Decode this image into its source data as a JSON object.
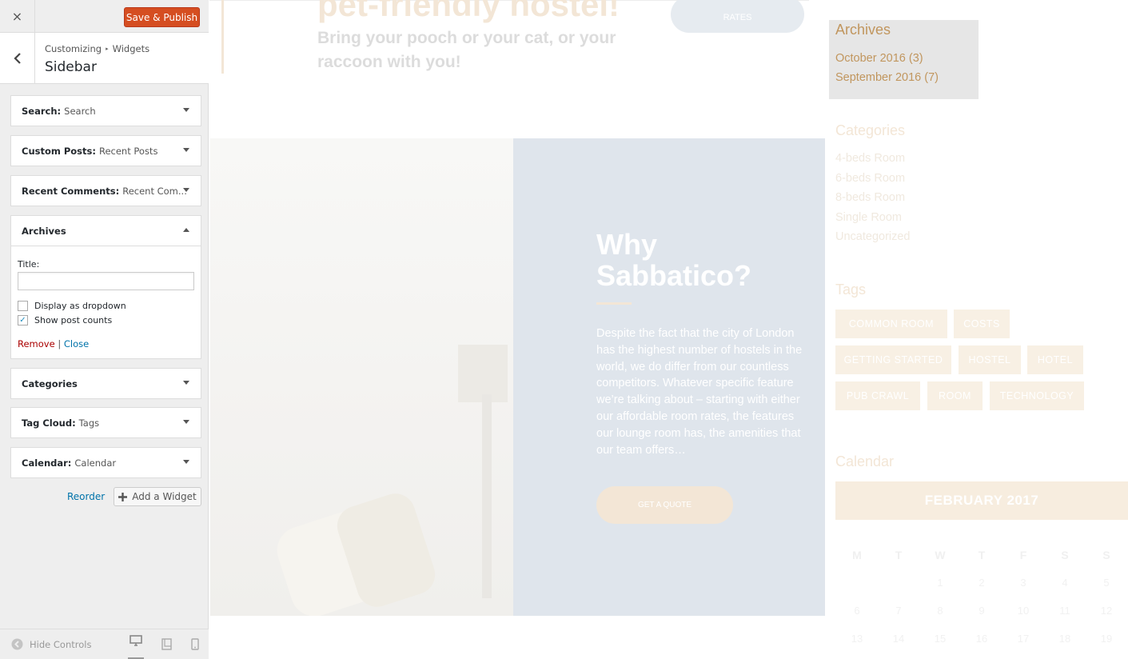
{
  "panel": {
    "save_label": "Save & Publish",
    "close_icon": "×",
    "breadcrumb": {
      "parent": "Customizing",
      "sep": "▸",
      "current": "Widgets"
    },
    "section_title": "Sidebar",
    "widgets": [
      {
        "name": "Search",
        "sub": "Search"
      },
      {
        "name": "Custom Posts",
        "sub": "Recent Posts"
      },
      {
        "name": "Recent Comments",
        "sub": "Recent Com..."
      },
      {
        "name": "Archives",
        "sub": ""
      },
      {
        "name": "Categories",
        "sub": ""
      },
      {
        "name": "Tag Cloud",
        "sub": "Tags"
      },
      {
        "name": "Calendar",
        "sub": "Calendar"
      }
    ],
    "archives_form": {
      "title_label": "Title:",
      "title_value": "",
      "dropdown_label": "Display as dropdown",
      "dropdown_checked": false,
      "counts_label": "Show post counts",
      "counts_checked": true,
      "remove_label": "Remove",
      "sep": "|",
      "close_label": "Close"
    },
    "reorder_label": "Reorder",
    "add_widget_label": "Add a Widget",
    "hide_controls_label": "Hide Controls",
    "colors": {
      "accent": "#d54e21",
      "link": "#0073aa",
      "remove": "#a00000"
    }
  },
  "preview": {
    "hero_title": "pet-friendly hostel!",
    "hero_subtitle": "Bring your pooch or your cat, or your raccoon with you!",
    "rates_label": "RATES",
    "why_title": "Why Sabbatico?",
    "why_body": "Despite the fact that the city of London has the highest number of hostels in the world, we do differ from our countless competitors. Whatever specific feature we’re talking about – starting with either our affordable room rates, the features our lounge room has, the amenities that our team offers…",
    "quote_label": "GET A QUOTE",
    "archives_title": "Archives",
    "archives": [
      "October 2016 (3)",
      "September 2016 (7)"
    ],
    "categories_title": "Categories",
    "categories": [
      "4-beds Room",
      "6-beds Room",
      "8-beds Room",
      "Single Room",
      "Uncategorized"
    ],
    "tags_title": "Tags",
    "tags": [
      "COMMON ROOM",
      "COSTS",
      "GETTING STARTED",
      "HOSTEL",
      "HOTEL",
      "PUB CRAWL",
      "ROOM",
      "TECHNOLOGY"
    ],
    "calendar_title": "Calendar",
    "calendar_month": "FEBRUARY 2017",
    "calendar_days": [
      "M",
      "T",
      "W",
      "T",
      "F",
      "S",
      "S"
    ],
    "calendar_rows": [
      [
        "",
        "",
        "1",
        "2",
        "3",
        "4",
        "5"
      ],
      [
        "6",
        "7",
        "8",
        "9",
        "10",
        "11",
        "12"
      ],
      [
        "13",
        "14",
        "15",
        "16",
        "17",
        "18",
        "19"
      ]
    ],
    "colors": {
      "gold": "#c1965e",
      "cream": "#f3e6d6",
      "card": "#dfe5ec"
    }
  }
}
